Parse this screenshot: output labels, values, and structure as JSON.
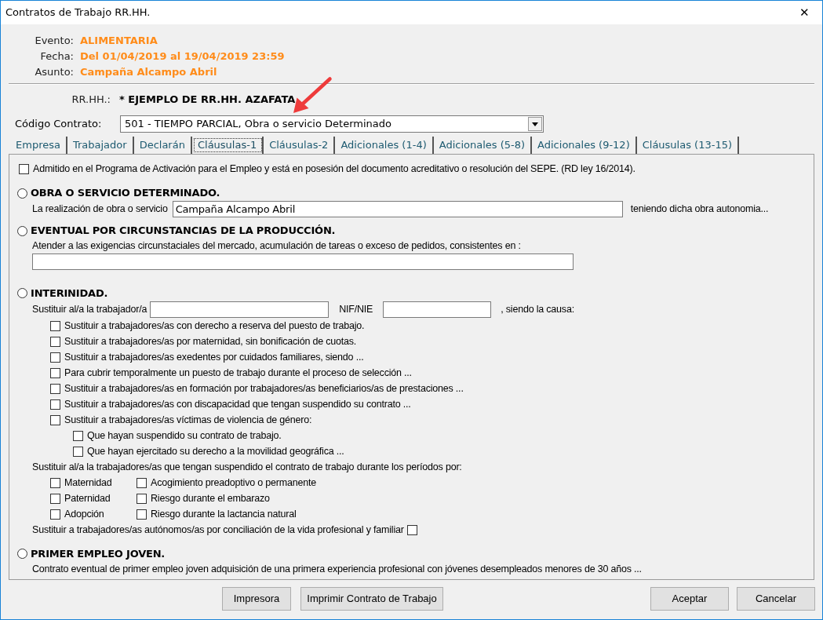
{
  "window": {
    "title": "Contratos de Trabajo RR.HH.",
    "close": "✕"
  },
  "header": [
    {
      "label": "Evento:",
      "value": "ALIMENTARIA"
    },
    {
      "label": "Fecha:",
      "value": "Del 01/04/2019 al 19/04/2019 23:59"
    },
    {
      "label": "Asunto:",
      "value": "Campaña Alcampo Abril"
    }
  ],
  "rrhh": {
    "label": "RR.HH.:",
    "value": "* EJEMPLO DE RR.HH. AZAFATA"
  },
  "contract": {
    "label": "Código Contrato:",
    "value": "501 - TIEMPO PARCIAL, Obra o servicio Determinado"
  },
  "tabs": [
    {
      "label": "Empresa",
      "selected": false
    },
    {
      "label": "Trabajador",
      "selected": false
    },
    {
      "label": "Declarán",
      "selected": false
    },
    {
      "label": "Cláusulas-1",
      "selected": true
    },
    {
      "label": "Cláusulas-2",
      "selected": false
    },
    {
      "label": "Adicionales (1-4)",
      "selected": false
    },
    {
      "label": "Adicionales (5-8)",
      "selected": false
    },
    {
      "label": "Adicionales (9-12)",
      "selected": false
    },
    {
      "label": "Cláusulas (13-15)",
      "selected": false
    }
  ],
  "admitted": {
    "label": "Admitido en el Programa de Activación para el Empleo y está en posesión del documento acreditativo o resolución del SEPE. (RD ley 16/2014).",
    "checked": false
  },
  "obra": {
    "title": "OBRA O SERVICIO DETERMINADO.",
    "selected": false,
    "label": "La realización de obra o servicio",
    "value": "Campaña Alcampo Abril",
    "suffix": "teniendo dicha obra autonomia..."
  },
  "eventual": {
    "title": "EVENTUAL POR CIRCUNSTANCIAS DE LA PRODUCCIÓN.",
    "selected": false,
    "label": "Atender a las exigencias circunstaciales del mercado, acumulación de tareas o exceso de pedidos,  consistentes en :"
  },
  "interinidad": {
    "title": "INTERINIDAD.",
    "selected": false,
    "label": "Sustituir al/a la trabajador/a",
    "nif_label": "NIF/NIE",
    "suffix": ", siendo la causa:",
    "causes": [
      {
        "label": "Sustituir a trabajadores/as con derecho a reserva del puesto de trabajo.",
        "checked": false
      },
      {
        "label": "Sustituir a trabajadores/as por maternidad, sin bonificación de cuotas.",
        "checked": false
      },
      {
        "label": "Sustituir a trabajadores/as exedentes por cuidados familiares, siendo ...",
        "checked": false
      },
      {
        "label": "Para cubrir temporalmente un puesto de trabajo durante el proceso de selección ...",
        "checked": false
      },
      {
        "label": "Sustituir a trabajadores/as en formación por trabajadores/as beneficiarios/as de prestaciones ...",
        "checked": false
      },
      {
        "label": "Sustituir a trabajadores/as con discapacidad que tengan suspendido su contrato ...",
        "checked": false
      },
      {
        "label": "Sustituir a trabajadores/as víctimas de violencia de género:",
        "checked": false,
        "children": [
          {
            "label": "Que hayan suspendido su contrato de trabajo.",
            "checked": false
          },
          {
            "label": "Que hayan ejercitado su derecho a la movilidad geográfica ...",
            "checked": false
          }
        ]
      }
    ],
    "periods_label": "Sustituir al/a la trabajadores/as que tengan suspendido el contrato de trabajo durante los períodos por:",
    "periods": [
      [
        {
          "label": "Maternidad",
          "checked": false
        },
        {
          "label": "Paternidad",
          "checked": false
        },
        {
          "label": "Adopción",
          "checked": false
        }
      ],
      [
        {
          "label": "Acogimiento preadoptivo o permanente",
          "checked": false
        },
        {
          "label": "Riesgo durante el embarazo",
          "checked": false
        },
        {
          "label": "Riesgo durante la lactancia natural",
          "checked": false
        }
      ]
    ],
    "autonomos": {
      "label": "Sustituir a trabajadores/as autónomos/as por conciliación de la vida profesional y familiar",
      "checked": false
    }
  },
  "primer": {
    "title": "PRIMER EMPLEO JOVEN.",
    "selected": false,
    "text": "Contrato eventual de primer empleo joven adquisición de una primera experiencia profesional con jóvenes desempleados menores de 30 años ..."
  },
  "buttons_left": [
    {
      "label": "Impresora"
    },
    {
      "label": "Imprimir Contrato de Trabajo"
    }
  ],
  "buttons_right": [
    {
      "label": "Aceptar"
    },
    {
      "label": "Cancelar"
    }
  ]
}
